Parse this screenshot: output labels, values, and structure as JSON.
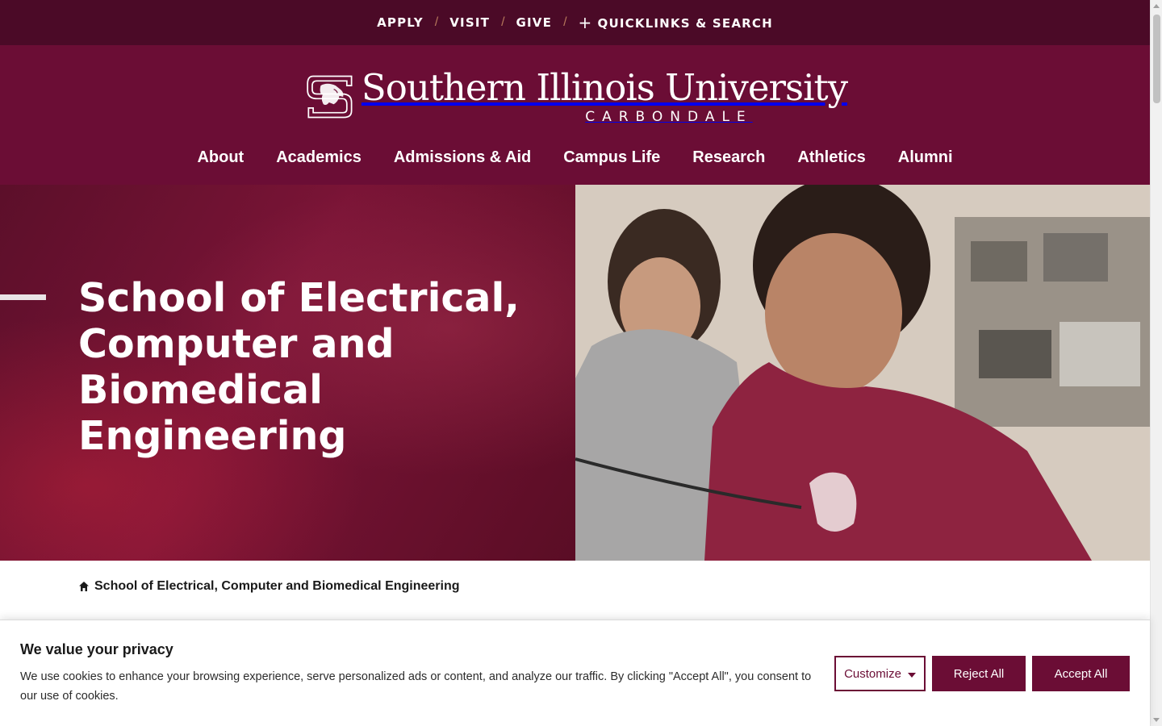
{
  "utility_nav": {
    "links": [
      "APPLY",
      "VISIT",
      "GIVE"
    ],
    "separator": "/",
    "quicklinks_label": "QUICKLINKS & SEARCH"
  },
  "header": {
    "university_name": "Southern Illinois University",
    "campus": "CARBONDALE"
  },
  "main_nav": [
    "About",
    "Academics",
    "Admissions & Aid",
    "Campus Life",
    "Research",
    "Athletics",
    "Alumni"
  ],
  "hero": {
    "title": "School of Electrical, Computer and Biomedical Engineering"
  },
  "breadcrumb": {
    "current": "School of Electrical, Computer and Biomedical Engineering"
  },
  "cookie_banner": {
    "title": "We value your privacy",
    "text": "We use cookies to enhance your browsing experience, serve personalized ads or content, and analyze our traffic. By clicking \"Accept All\", you consent to our use of cookies.",
    "customize_label": "Customize",
    "reject_label": "Reject All",
    "accept_label": "Accept All"
  },
  "colors": {
    "maroon": "#6b0d35",
    "dark_maroon": "#4b0a27",
    "separator": "#b5765a"
  },
  "icons": {
    "plus": "plus-icon",
    "home": "home-icon",
    "customize_caret": "caret-down-icon"
  }
}
